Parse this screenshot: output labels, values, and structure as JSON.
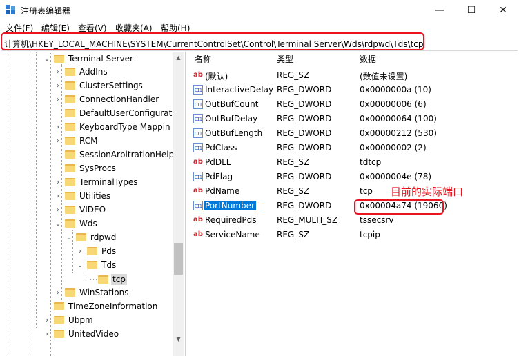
{
  "window": {
    "title": "注册表编辑器",
    "controls": {
      "minimize": "—",
      "maximize": "☐",
      "close": "✕"
    }
  },
  "menu": [
    "文件(F)",
    "编辑(E)",
    "查看(V)",
    "收藏夹(A)",
    "帮助(H)"
  ],
  "address": "计算机\\HKEY_LOCAL_MACHINE\\SYSTEM\\CurrentControlSet\\Control\\Terminal Server\\Wds\\rdpwd\\Tds\\tcp",
  "tree": [
    {
      "label": "Terminal Server",
      "expanded": true
    },
    {
      "label": "AddIns"
    },
    {
      "label": "ClusterSettings"
    },
    {
      "label": "ConnectionHandler"
    },
    {
      "label": "DefaultUserConfiguratio"
    },
    {
      "label": "KeyboardType Mappin"
    },
    {
      "label": "RCM"
    },
    {
      "label": "SessionArbitrationHelp"
    },
    {
      "label": "SysProcs"
    },
    {
      "label": "TerminalTypes"
    },
    {
      "label": "Utilities"
    },
    {
      "label": "VIDEO"
    },
    {
      "label": "Wds",
      "expanded": true
    },
    {
      "label": "rdpwd",
      "expanded": true
    },
    {
      "label": "Pds"
    },
    {
      "label": "Tds",
      "expanded": true
    },
    {
      "label": "tcp",
      "selected": true
    },
    {
      "label": "WinStations"
    },
    {
      "label": "TimeZoneInformation"
    },
    {
      "label": "Ubpm"
    },
    {
      "label": "UnitedVideo"
    }
  ],
  "columns": {
    "name": "名称",
    "type": "类型",
    "data": "数据"
  },
  "values": [
    {
      "icon": "string-value-icon",
      "name": "(默认)",
      "type": "REG_SZ",
      "data": "(数值未设置)"
    },
    {
      "icon": "binary-value-icon",
      "name": "InteractiveDelay",
      "type": "REG_DWORD",
      "data": "0x0000000a (10)"
    },
    {
      "icon": "binary-value-icon",
      "name": "OutBufCount",
      "type": "REG_DWORD",
      "data": "0x00000006 (6)"
    },
    {
      "icon": "binary-value-icon",
      "name": "OutBufDelay",
      "type": "REG_DWORD",
      "data": "0x00000064 (100)"
    },
    {
      "icon": "binary-value-icon",
      "name": "OutBufLength",
      "type": "REG_DWORD",
      "data": "0x00000212 (530)"
    },
    {
      "icon": "binary-value-icon",
      "name": "PdClass",
      "type": "REG_DWORD",
      "data": "0x00000002 (2)"
    },
    {
      "icon": "string-value-icon",
      "name": "PdDLL",
      "type": "REG_SZ",
      "data": "tdtcp"
    },
    {
      "icon": "binary-value-icon",
      "name": "PdFlag",
      "type": "REG_DWORD",
      "data": "0x0000004e (78)"
    },
    {
      "icon": "string-value-icon",
      "name": "PdName",
      "type": "REG_SZ",
      "data": "tcp"
    },
    {
      "icon": "binary-value-icon",
      "name": "PortNumber",
      "type": "REG_DWORD",
      "data": "0x00004a74 (19060)",
      "selected": true
    },
    {
      "icon": "string-value-icon",
      "name": "RequiredPds",
      "type": "REG_MULTI_SZ",
      "data": "tssecsrv"
    },
    {
      "icon": "string-value-icon",
      "name": "ServiceName",
      "type": "REG_SZ",
      "data": "tcpip"
    }
  ],
  "annotation": "目前的实际端口",
  "colors": {
    "highlight": "#e8141f",
    "selection": "#0078d7",
    "folder": "#f8d775"
  }
}
